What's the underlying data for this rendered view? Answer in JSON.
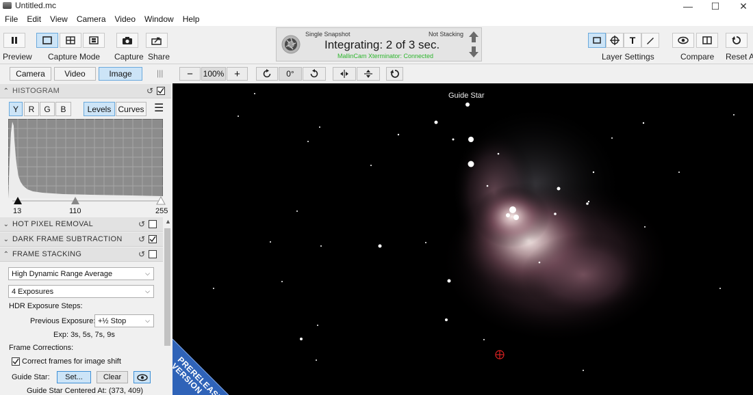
{
  "window": {
    "title": "Untitled.mc",
    "minimize": "—",
    "maximize": "☐",
    "close": "✕"
  },
  "menu": [
    "File",
    "Edit",
    "View",
    "Camera",
    "Video",
    "Window",
    "Help"
  ],
  "toolbar": {
    "preview": "Preview",
    "capture_mode": "Capture Mode",
    "capture": "Capture",
    "share": "Share",
    "layer_settings": "Layer Settings",
    "compare": "Compare",
    "reset_all": "Reset All"
  },
  "status": {
    "mode": "Single Snapshot",
    "stacking": "Not Stacking",
    "main": "Integrating: 2 of 3 sec.",
    "connection": "MallinCam Xterminator: Connected",
    "connection_color": "#2db52d"
  },
  "view_tabs": [
    "Camera",
    "Video",
    "Image"
  ],
  "zoom": {
    "level": "100%",
    "rotation": "0°",
    "minus": "−",
    "plus": "+"
  },
  "histogram": {
    "title": "HISTOGRAM",
    "channels": [
      "Y",
      "R",
      "G",
      "B"
    ],
    "modes": [
      "Levels",
      "Curves"
    ],
    "black": "13",
    "mid": "110",
    "white": "255",
    "black_value": 13,
    "mid_value": 110,
    "white_value": 255
  },
  "sections": {
    "hot_pixel": "HOT PIXEL REMOVAL",
    "dark_frame": "DARK FRAME SUBTRACTION",
    "frame_stacking": "FRAME STACKING",
    "dark_frame_checked": "✓"
  },
  "stacking": {
    "method": "High Dynamic Range Average",
    "exposures": "4 Exposures",
    "hdr_label": "HDR Exposure Steps:",
    "prev_label": "Previous Exposure:",
    "prev_value": "+½ Stop",
    "exp_text": "Exp: 3s, 5s, 7s, 9s",
    "corrections_label": "Frame Corrections:",
    "correct_shift": "Correct frames for image shift",
    "correct_shift_checked": "✓",
    "guide_star_label": "Guide Star:",
    "set_button": "Set...",
    "clear_button": "Clear",
    "centered_text": "Guide Star Centered At: (373, 409)"
  },
  "image": {
    "guide_star_label": "Guide Star",
    "banner": "PRERELEASE VERSION"
  }
}
